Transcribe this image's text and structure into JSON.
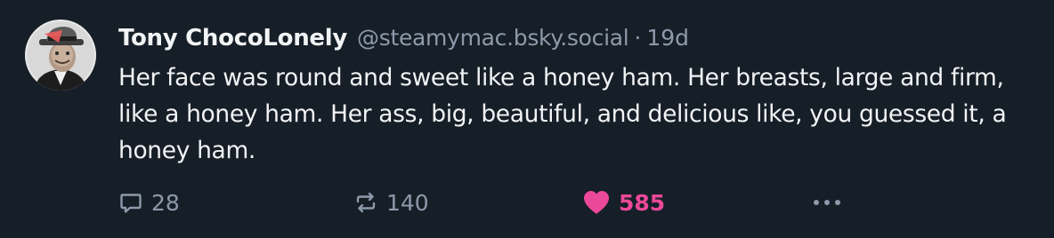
{
  "post": {
    "display_name": "Tony ChocoLonely",
    "handle": "@steamymac.bsky.social",
    "separator": "·",
    "time": "19d",
    "text": "Her face was round and sweet like a honey ham. Her breasts, large and firm, like a honey ham. Her ass, big, beautiful, and delicious like, you guessed it, a honey ham.",
    "avatar_icon": "avatar-man-in-fedora"
  },
  "actions": {
    "reply": {
      "icon": "reply-icon",
      "count": "28"
    },
    "repost": {
      "icon": "repost-icon",
      "count": "140"
    },
    "like": {
      "icon": "heart-icon",
      "count": "585",
      "liked": true
    },
    "more": {
      "icon": "more-icon"
    }
  },
  "colors": {
    "background": "#161e27",
    "text": "#f1f3f5",
    "muted": "#8d9aaa",
    "like": "#ec4899"
  }
}
